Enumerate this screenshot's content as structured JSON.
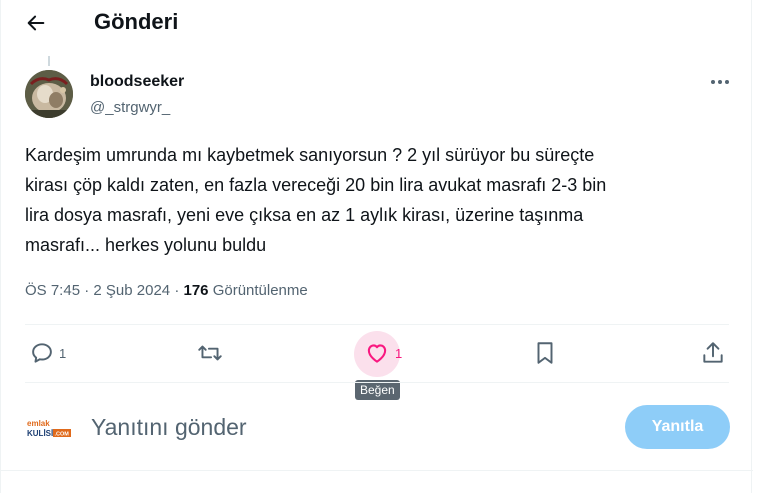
{
  "header": {
    "title": "Gönderi"
  },
  "post": {
    "author_name": "bloodseeker",
    "author_handle": "@_strgwyr_",
    "text_lines": [
      "Kardeşim umrunda mı kaybetmek sanıyorsun ? 2 yıl sürüyor bu süreçte",
      "kirası çöp kaldı zaten, en fazla vereceği 20 bin lira avukat masrafı 2-3 bin",
      "lira dosya masrafı, yeni eve çıksa en az 1 aylık kirası, üzerine taşınma",
      "masrafı... herkes yolunu buldu"
    ],
    "time": "ÖS 7:45",
    "date": "2 Şub 2024",
    "views_count": "176",
    "views_label": "Görüntülenme",
    "separator": "·"
  },
  "actions": {
    "reply_count": "1",
    "like_count": "1",
    "like_tooltip": "Beğen"
  },
  "reply_box": {
    "logo_line1": "emlak",
    "logo_line2": "KULİSİ",
    "logo_badge": ".COM",
    "placeholder": "Yanıtını gönder",
    "button_label": "Yanıtla"
  },
  "colors": {
    "secondary_text": "#536471",
    "like_highlight": "#f91880",
    "reply_button": "#8ecdf8"
  },
  "icons": [
    "back-arrow-icon",
    "more-icon",
    "reply-icon",
    "retweet-icon",
    "heart-icon",
    "bookmark-icon",
    "share-icon"
  ]
}
